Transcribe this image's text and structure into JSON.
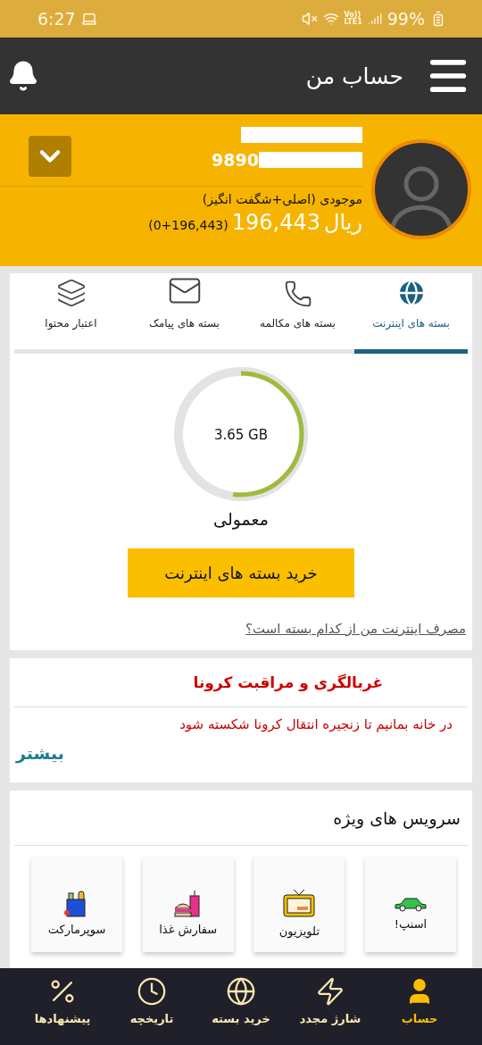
{
  "status_bar": {
    "time": "6:27",
    "volte": "Vo))",
    "network": "LTE1",
    "battery": "99%"
  },
  "app_bar": {
    "title": "حساب من"
  },
  "profile": {
    "phone_prefix": "9890",
    "balance_label": "موجودی (اصلی+شگفت انگیز)",
    "currency": "ریال",
    "balance": "196,443",
    "balance_detail": "(0+196,443)"
  },
  "tabs": [
    {
      "label": "بسته های اینترنت",
      "kind": "globe",
      "selected": true
    },
    {
      "label": "بسته های مکالمه",
      "kind": "phone",
      "selected": false
    },
    {
      "label": "بسته های پیامک",
      "kind": "mail",
      "selected": false
    },
    {
      "label": "اعتبار محتوا",
      "kind": "layers",
      "selected": false
    }
  ],
  "usage": {
    "amount": "3.65 GB",
    "level": 0.52,
    "plan": "معمولی",
    "buy_button": "خرید بسته های اینترنت",
    "question_link": "مصرف اینترنت من از کدام بسته است؟"
  },
  "notice": {
    "title": "غربالگری و مراقبت کرونا",
    "message": "در خانه بمانیم تا زنجیره انتقال کرونا شکسته شود",
    "more_link": "بیشتر"
  },
  "services": {
    "title": "سرویس های ویژه",
    "items": [
      {
        "label": "اسنپ!",
        "kind": "car"
      },
      {
        "label": "تلویزیون",
        "kind": "tv"
      },
      {
        "label": "سفارش غذا",
        "kind": "food"
      },
      {
        "label": "سوپرمارکت",
        "kind": "grocery"
      }
    ]
  },
  "bottom_nav": [
    {
      "label": "حساب",
      "kind": "user",
      "selected": true
    },
    {
      "label": "شارژ مجدد",
      "kind": "zap",
      "selected": false
    },
    {
      "label": "خرید بسته",
      "kind": "globe",
      "selected": false
    },
    {
      "label": "تاریخچه",
      "kind": "clock",
      "selected": false
    },
    {
      "label": "پیشنهادها",
      "kind": "percent",
      "selected": false
    }
  ]
}
